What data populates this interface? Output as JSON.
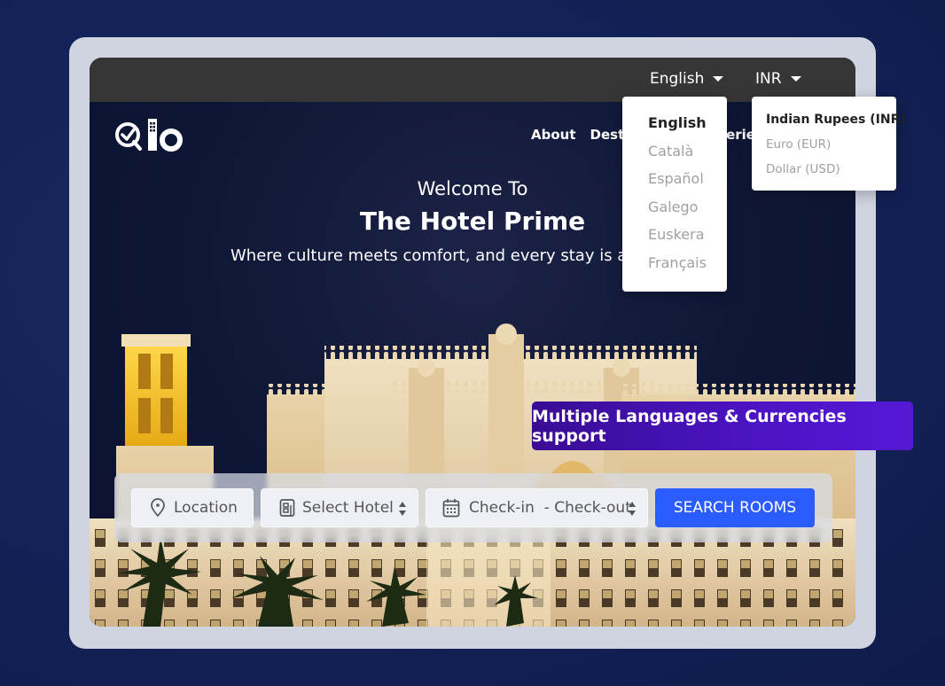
{
  "topbar": {
    "language_selected": "English",
    "currency_selected": "INR"
  },
  "language_menu": {
    "options": [
      "English",
      "Català",
      "Español",
      "Galego",
      "Euskera",
      "Français"
    ],
    "active_index": 0
  },
  "currency_menu": {
    "options": [
      "Indian Rupees (INR)",
      "Euro (EUR)",
      "Dollar (USD)"
    ],
    "active_index": 0
  },
  "nav": {
    "items": [
      "About",
      "Destinations",
      "Experience"
    ]
  },
  "hero": {
    "welcome": "Welcome To",
    "title": "The Hotel Prime",
    "tagline": "Where culture meets comfort, and every stay is a d"
  },
  "search": {
    "location_placeholder": "Location",
    "hotel_placeholder": "Select Hotel",
    "dates_placeholder": "Check-in  - Check-out",
    "button_label": "SEARCH ROOMS",
    "button_color": "#2b5cff"
  },
  "banner": {
    "text": "Multiple Languages & Currencies support",
    "color": "#4c14c4"
  },
  "icons": {
    "logo": "qlo-logo",
    "location": "map-pin-icon",
    "hotel": "building-icon",
    "calendar": "calendar-icon",
    "sort": "sort-updown-icon",
    "caret": "caret-down-icon"
  }
}
